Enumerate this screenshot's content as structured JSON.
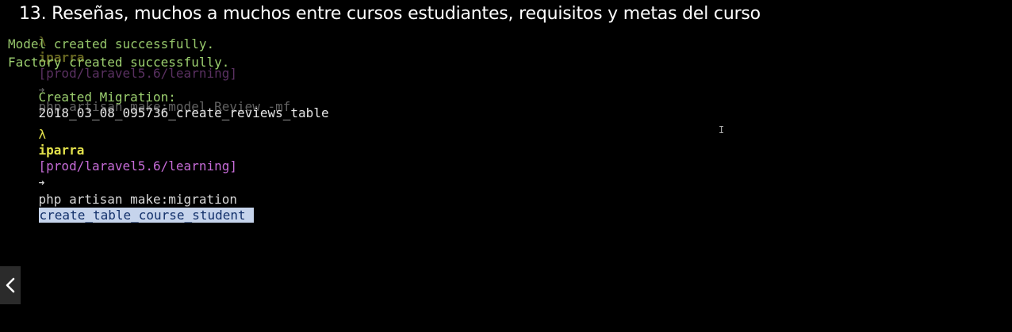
{
  "video": {
    "title": "13. Reseñas, muchos a muchos entre cursos estudiantes, requisitos y metas del curso"
  },
  "terminal": {
    "line1": {
      "lambda": "λ",
      "user": "iparra",
      "path": "[prod/laravel5.6/learning]",
      "arrow": "➜",
      "command": "php artisan make:model Review -mf"
    },
    "line2": "Model created successfully.",
    "line3": "Factory created successfully.",
    "line4": {
      "label": "Created Migration:",
      "name": "2018_03_08_095736_create_reviews_table"
    },
    "line5": {
      "lambda": "λ",
      "user": "iparra",
      "path": "[prod/laravel5.6/learning]",
      "arrow": "➜",
      "command": "php artisan make:migration",
      "selected_argument": "create_table_course_student"
    }
  },
  "controls": {
    "prev_icon": "chevron-left-icon"
  },
  "colors": {
    "background": "#000000",
    "prompt_user": "#e2e04b",
    "prompt_path": "#c56bd6",
    "success_text": "#9ccf6f",
    "selection_bg": "#c6d4ec"
  }
}
